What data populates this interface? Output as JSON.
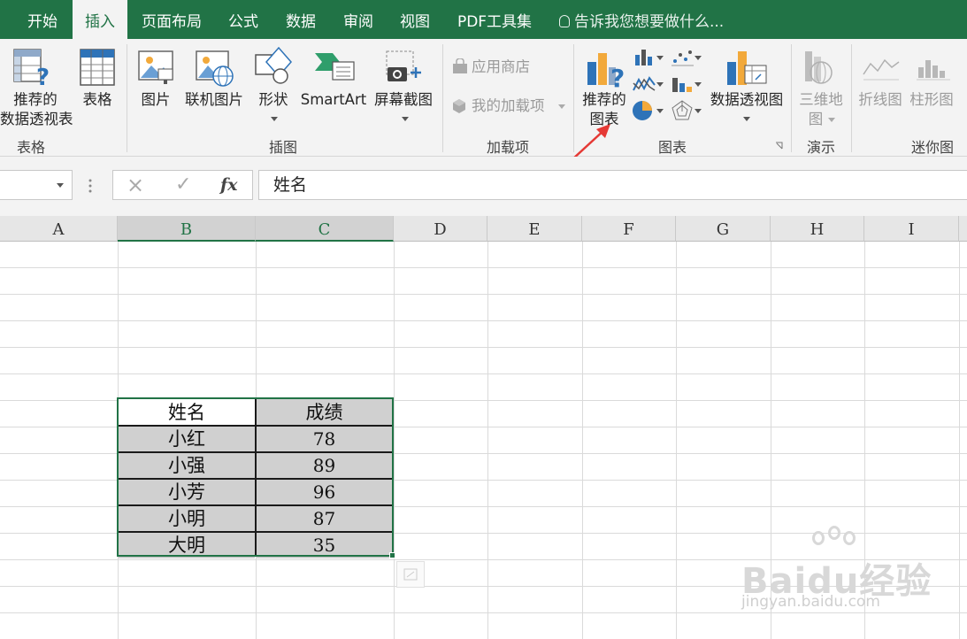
{
  "tabs": [
    {
      "label": "开始"
    },
    {
      "label": "插入",
      "active": true
    },
    {
      "label": "页面布局"
    },
    {
      "label": "公式"
    },
    {
      "label": "数据"
    },
    {
      "label": "审阅"
    },
    {
      "label": "视图"
    },
    {
      "label": "PDF工具集"
    }
  ],
  "tell_me": "告诉我您想要做什么...",
  "ribbon": {
    "groups": {
      "tables": "表格",
      "illustrations": "插图",
      "addins": "加载项",
      "charts": "图表",
      "tours": "演示",
      "sparklines": "迷你图"
    },
    "buttons": {
      "rec_pivot_line1": "推荐的",
      "rec_pivot_line2": "数据透视表",
      "table": "表格",
      "pictures": "图片",
      "online_pictures": "联机图片",
      "shapes": "形状",
      "smartart": "SmartArt",
      "screenshot": "屏幕截图",
      "store": "应用商店",
      "my_addins": "我的加载项",
      "rec_charts_line1": "推荐的",
      "rec_charts_line2": "图表",
      "pivot_chart": "数据透视图",
      "map3d_line1": "三维地",
      "map3d_line2": "图",
      "line_spark": "折线图",
      "column_spark": "柱形图"
    }
  },
  "formula_bar": {
    "name_box": "",
    "cancel_icon": "×",
    "enter_icon": "✓",
    "fx_label": "fx",
    "value": "姓名"
  },
  "columns": [
    "A",
    "B",
    "C",
    "D",
    "E",
    "F",
    "G",
    "H",
    "I"
  ],
  "table": {
    "headers": [
      "姓名",
      "成绩"
    ],
    "rows": [
      [
        "小红",
        "78"
      ],
      [
        "小强",
        "89"
      ],
      [
        "小芳",
        "96"
      ],
      [
        "小明",
        "87"
      ],
      [
        "大明",
        "35"
      ]
    ]
  },
  "watermark": {
    "main": "Baidu经验",
    "sub": "jingyan.baidu.com"
  },
  "colors": {
    "accent": "#217346",
    "arrow": "#e53935"
  }
}
